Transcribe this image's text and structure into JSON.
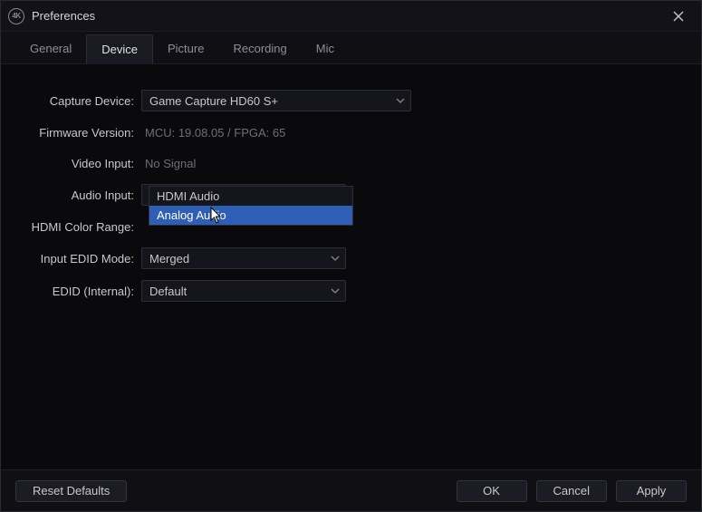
{
  "window": {
    "title": "Preferences",
    "icon_text": "4K"
  },
  "tabs": {
    "general": "General",
    "device": "Device",
    "picture": "Picture",
    "recording": "Recording",
    "mic": "Mic"
  },
  "labels": {
    "capture_device": "Capture Device:",
    "firmware_version": "Firmware Version:",
    "video_input": "Video Input:",
    "audio_input": "Audio Input:",
    "hdmi_color_range": "HDMI Color Range:",
    "input_edid_mode": "Input EDID Mode:",
    "edid_internal": "EDID (Internal):"
  },
  "values": {
    "capture_device": "Game Capture HD60 S+",
    "firmware_version": "MCU: 19.08.05 / FPGA: 65",
    "video_input": "No Signal",
    "audio_input": "Analog Audio",
    "input_edid_mode": "Merged",
    "edid_internal": "Default"
  },
  "audio_input_dropdown": {
    "options": [
      "HDMI Audio",
      "Analog Audio"
    ],
    "selected_index": 1
  },
  "footer": {
    "reset": "Reset Defaults",
    "ok": "OK",
    "cancel": "Cancel",
    "apply": "Apply"
  }
}
